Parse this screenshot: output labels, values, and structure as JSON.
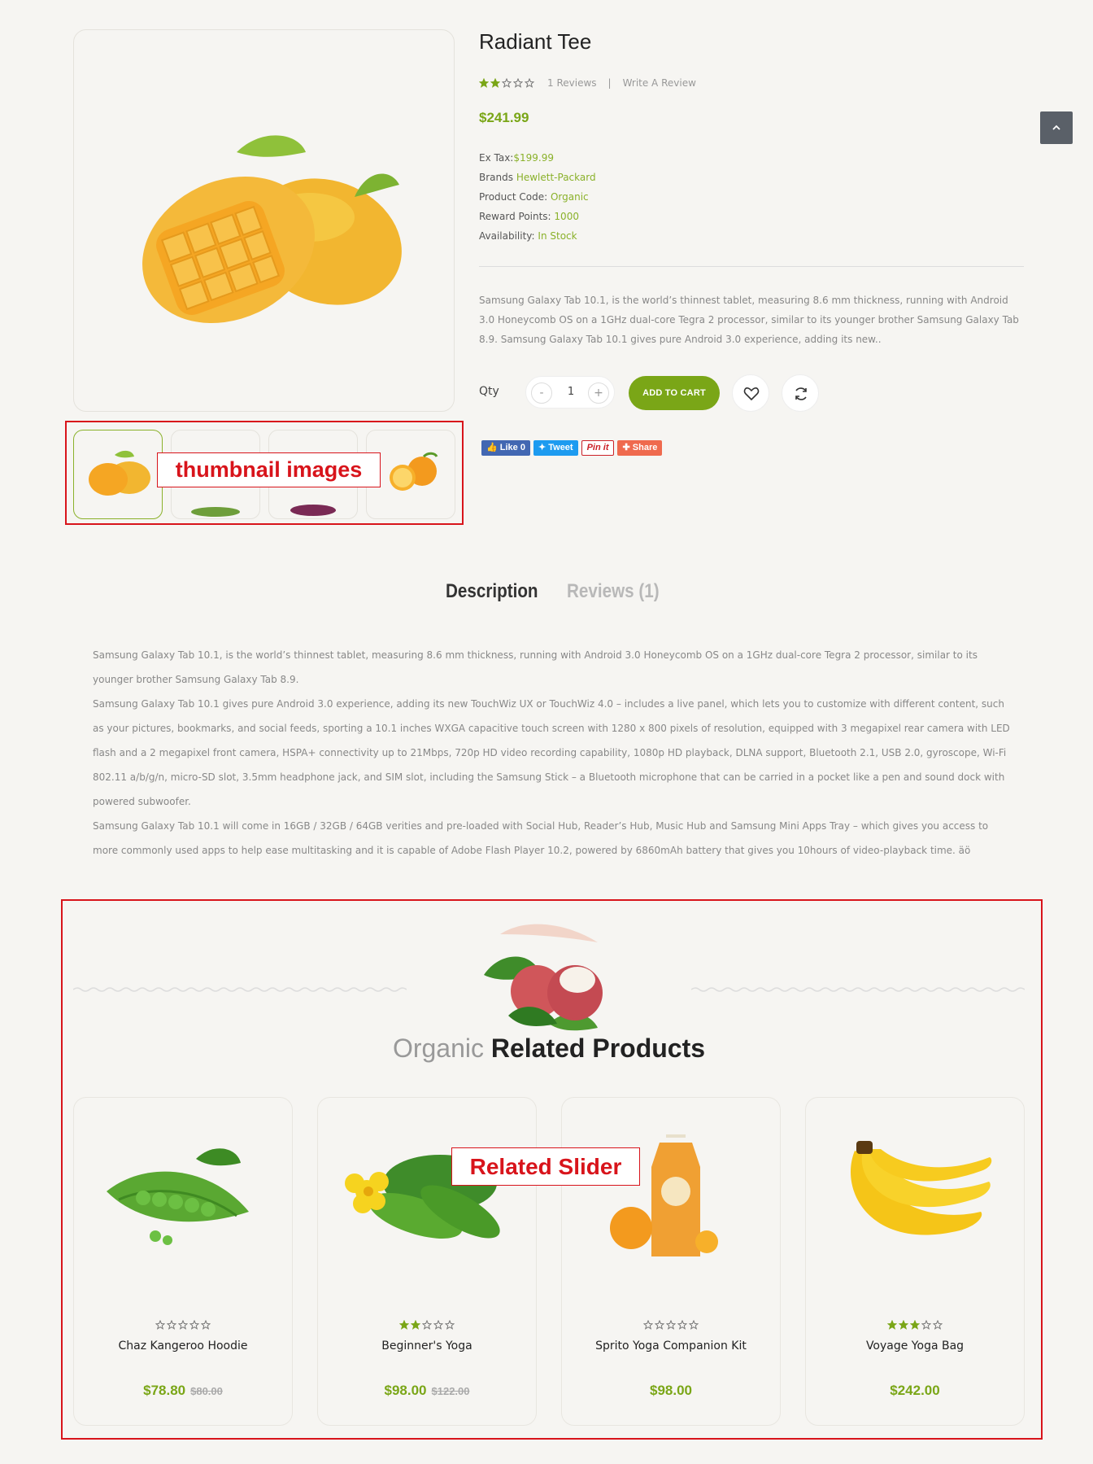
{
  "product": {
    "title": "Radiant Tee",
    "rating": 2,
    "reviews_link": "1 Reviews",
    "write_review": "Write A Review",
    "separator": "|",
    "price": "$241.99",
    "meta": {
      "ex_tax_label": "Ex Tax:",
      "ex_tax_value": "$199.99",
      "brands_label": "Brands",
      "brands_value": "Hewlett-Packard",
      "code_label": "Product Code:",
      "code_value": "Organic",
      "reward_label": "Reward Points:",
      "reward_value": "1000",
      "avail_label": "Availability:",
      "avail_value": "In Stock"
    },
    "short_description": "Samsung Galaxy Tab 10.1, is the world’s thinnest tablet, measuring 8.6 mm thickness, running with Android 3.0 Honeycomb OS on a 1GHz dual-core Tegra 2 processor, similar to its younger brother Samsung Galaxy Tab 8.9. Samsung Galaxy Tab 10.1 gives pure Android 3.0 experience, adding its new..",
    "qty_label": "Qty",
    "qty_value": "1",
    "qty_minus": "-",
    "qty_plus": "+",
    "add_to_cart": "ADD TO CART"
  },
  "share": {
    "facebook": "Like 0",
    "twitter": "Tweet",
    "pinterest": "Pin it",
    "share": "Share"
  },
  "annotations": {
    "thumbnails": "thumbnail images",
    "related": "Related Slider"
  },
  "tabs": [
    {
      "label": "Description",
      "active": true
    },
    {
      "label": "Reviews (1)",
      "active": false
    }
  ],
  "description": [
    "Samsung Galaxy Tab 10.1, is the world’s thinnest tablet, measuring 8.6 mm thickness, running with Android 3.0 Honeycomb OS on a 1GHz dual-core Tegra 2 processor, similar to its younger brother Samsung Galaxy Tab 8.9.",
    "Samsung Galaxy Tab 10.1 gives pure Android 3.0 experience, adding its new TouchWiz UX or TouchWiz 4.0 – includes a live panel, which lets you to customize with different content, such as your pictures, bookmarks, and social feeds, sporting a 10.1 inches WXGA capacitive touch screen with 1280 x 800 pixels of resolution, equipped with 3 megapixel rear camera with LED flash and a 2 megapixel front camera, HSPA+ connectivity up to 21Mbps, 720p HD video recording capability, 1080p HD playback, DLNA support, Bluetooth 2.1, USB 2.0, gyroscope, Wi-Fi 802.11 a/b/g/n, micro-SD slot, 3.5mm headphone jack, and SIM slot, including the Samsung Stick – a Bluetooth microphone that can be carried in a pocket like a pen and sound dock with powered subwoofer.",
    "Samsung Galaxy Tab 10.1 will come in 16GB / 32GB / 64GB verities and pre-loaded with Social Hub, Reader’s Hub, Music Hub and Samsung Mini Apps Tray – which gives you access to more commonly used apps to help ease multitasking and it is capable of Adobe Flash Player 10.2, powered by 6860mAh battery that gives you 10hours of video-playback time. äö"
  ],
  "related": {
    "heading_light": "Organic",
    "heading_bold": "Related Products",
    "products": [
      {
        "name": "Chaz Kangeroo Hoodie",
        "price": "$78.80",
        "old_price": "$80.00",
        "rating": 0,
        "image": "peas"
      },
      {
        "name": "Beginner's Yoga",
        "price": "$98.00",
        "old_price": "$122.00",
        "rating": 2,
        "image": "cucumber"
      },
      {
        "name": "Sprito Yoga Companion Kit",
        "price": "$98.00",
        "old_price": "",
        "rating": 0,
        "image": "juice"
      },
      {
        "name": "Voyage Yoga Bag",
        "price": "$242.00",
        "old_price": "",
        "rating": 3,
        "image": "banana"
      }
    ]
  },
  "colors": {
    "accent": "#7aa617",
    "annotation": "#d8141b",
    "background": "#f6f5f2"
  }
}
